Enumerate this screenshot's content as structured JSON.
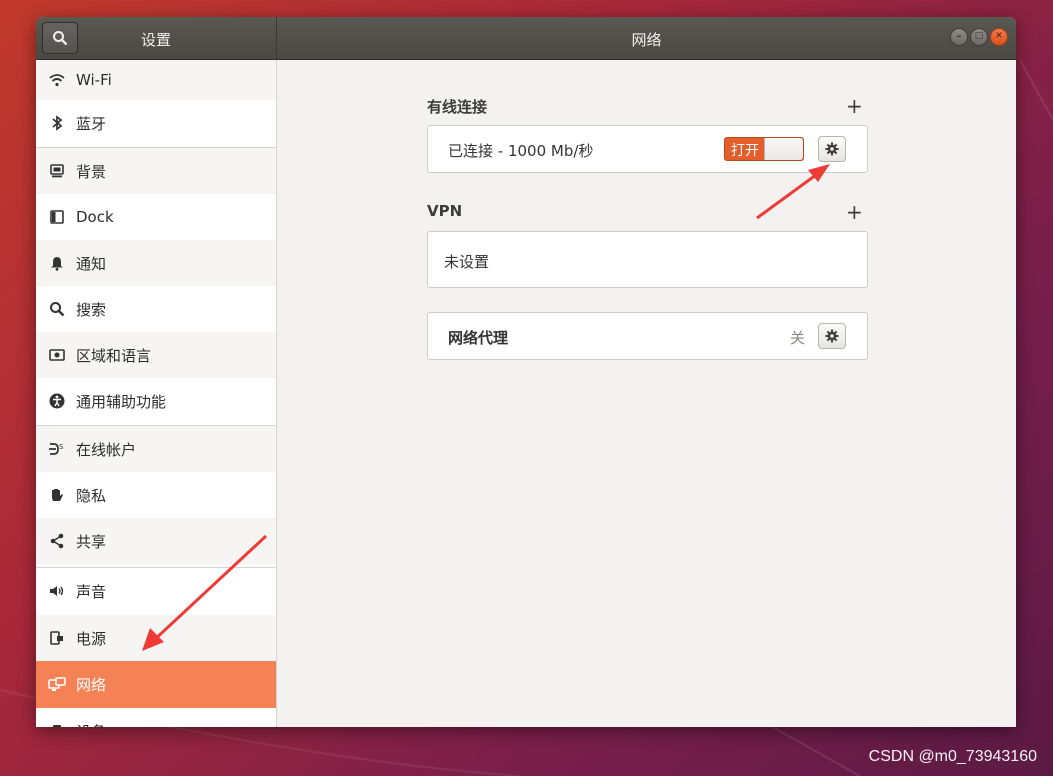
{
  "window": {
    "sidebar_title": "设置",
    "title": "网络"
  },
  "sidebar": {
    "items": [
      {
        "label": "Wi-Fi",
        "icon": "wifi-icon"
      },
      {
        "label": "蓝牙",
        "icon": "bluetooth-icon"
      },
      {
        "label": "背景",
        "icon": "background-icon"
      },
      {
        "label": "Dock",
        "icon": "dock-icon"
      },
      {
        "label": "通知",
        "icon": "bell-icon"
      },
      {
        "label": "搜索",
        "icon": "search-icon"
      },
      {
        "label": "区域和语言",
        "icon": "region-icon"
      },
      {
        "label": "通用辅助功能",
        "icon": "accessibility-icon"
      },
      {
        "label": "在线帐户",
        "icon": "online-accounts-icon"
      },
      {
        "label": "隐私",
        "icon": "hand-icon"
      },
      {
        "label": "共享",
        "icon": "share-icon"
      },
      {
        "label": "声音",
        "icon": "speaker-icon"
      },
      {
        "label": "电源",
        "icon": "power-icon"
      },
      {
        "label": "网络",
        "icon": "network-icon"
      },
      {
        "label": "设备",
        "icon": "device-icon"
      }
    ],
    "active_index": 13
  },
  "wired": {
    "title": "有线连接",
    "add": "+",
    "status": "已连接 - 1000 Mb/秒",
    "toggle_label": "打开",
    "toggle_on": true
  },
  "vpn": {
    "title": "VPN",
    "add": "+",
    "empty": "未设置"
  },
  "proxy": {
    "label": "网络代理",
    "state": "关"
  },
  "watermark": "CSDN @m0_73943160",
  "colors": {
    "accent": "#f48254",
    "toggle": "#e45e2c",
    "arrow": "#ef3b36"
  }
}
